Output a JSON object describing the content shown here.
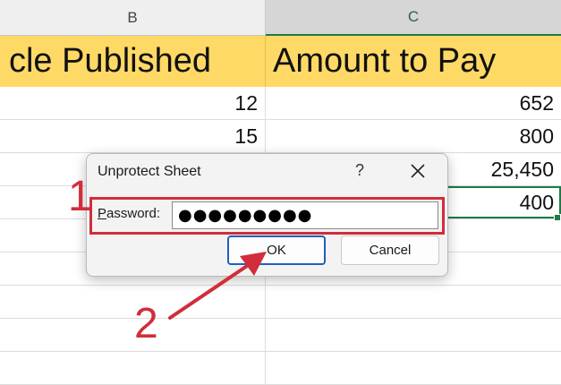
{
  "columns": {
    "b_letter": "B",
    "c_letter": "C"
  },
  "headers": {
    "b": "cle Published",
    "c": "Amount to Pay"
  },
  "rows": [
    {
      "b": "12",
      "c": "652"
    },
    {
      "b": "15",
      "c": "800"
    },
    {
      "b": "",
      "c": "25,450"
    },
    {
      "b": "",
      "c": "400"
    }
  ],
  "dialog": {
    "title": "Unprotect Sheet",
    "help": "?",
    "password_label_access": "P",
    "password_label_rest": "assword:",
    "password_value": "●●●●●●●●●",
    "ok_label": "OK",
    "cancel_label": "Cancel"
  },
  "annotations": {
    "step1": "1",
    "step2": "2"
  },
  "colors": {
    "header_fill": "#ffd966",
    "annotation_red": "#d12d3a",
    "selection_green": "#1e7b45"
  },
  "icons": {
    "close": "close-icon"
  }
}
